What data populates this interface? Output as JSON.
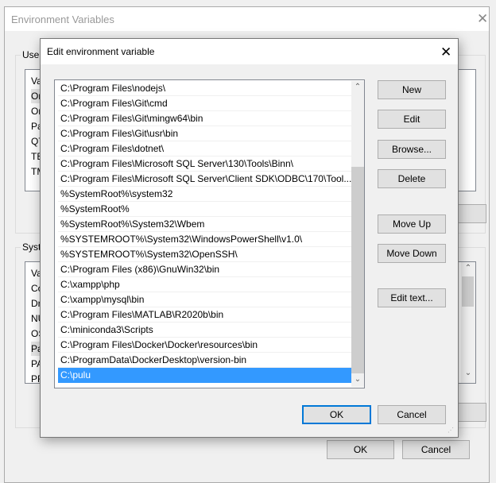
{
  "background_window": {
    "title": "Environment Variables",
    "user_group_label": "User",
    "user_list": [
      "Va",
      "Or",
      "Or",
      "Pa",
      "QT",
      "TE",
      "TM"
    ],
    "system_group_label": "Syste",
    "system_list": [
      "Va",
      "Co",
      "Dr",
      "NU",
      "OS",
      "Pa",
      "PA",
      "PR"
    ],
    "ok_label": "OK",
    "cancel_label": "Cancel"
  },
  "dialog": {
    "title": "Edit environment variable",
    "paths": [
      "C:\\Program Files\\nodejs\\",
      "C:\\Program Files\\Git\\cmd",
      "C:\\Program Files\\Git\\mingw64\\bin",
      "C:\\Program Files\\Git\\usr\\bin",
      "C:\\Program Files\\dotnet\\",
      "C:\\Program Files\\Microsoft SQL Server\\130\\Tools\\Binn\\",
      "C:\\Program Files\\Microsoft SQL Server\\Client SDK\\ODBC\\170\\Tool...",
      "%SystemRoot%\\system32",
      "%SystemRoot%",
      "%SystemRoot%\\System32\\Wbem",
      "%SYSTEMROOT%\\System32\\WindowsPowerShell\\v1.0\\",
      "%SYSTEMROOT%\\System32\\OpenSSH\\",
      "C:\\Program Files (x86)\\GnuWin32\\bin",
      "C:\\xampp\\php",
      "C:\\xampp\\mysql\\bin",
      "C:\\Program Files\\MATLAB\\R2020b\\bin",
      "C:\\miniconda3\\Scripts",
      "C:\\Program Files\\Docker\\Docker\\resources\\bin",
      "C:\\ProgramData\\DockerDesktop\\version-bin",
      "C:\\pulu"
    ],
    "selected_index": 19,
    "buttons": {
      "new": "New",
      "edit": "Edit",
      "browse": "Browse...",
      "delete": "Delete",
      "move_up": "Move Up",
      "move_down": "Move Down",
      "edit_text": "Edit text..."
    },
    "ok_label": "OK",
    "cancel_label": "Cancel"
  },
  "colors": {
    "selection": "#3399ff",
    "default_button_border": "#0078d7"
  }
}
